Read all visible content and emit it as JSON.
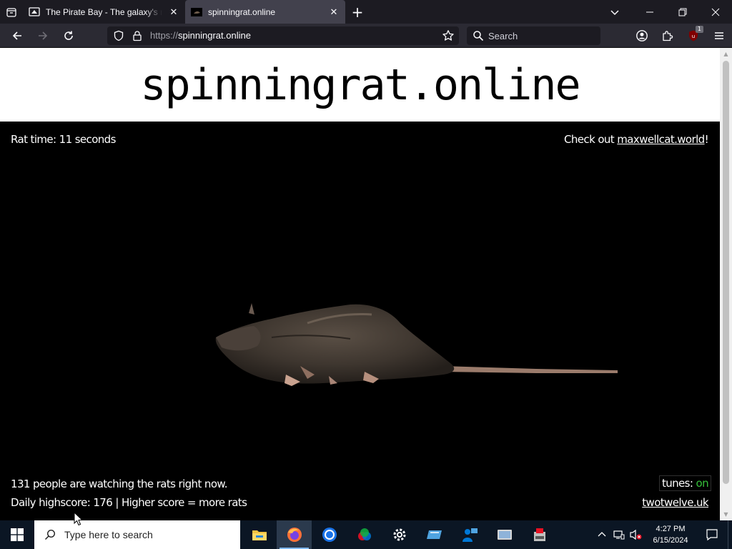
{
  "browser": {
    "tabs": [
      {
        "title": "The Pirate Bay - The galaxy's most resilient BitTorrent site",
        "active": false
      },
      {
        "title": "spinningrat.online",
        "active": true
      }
    ],
    "url_scheme": "https://",
    "url_host": "spinningrat.online",
    "search_placeholder": "Search",
    "extension_badge": "1"
  },
  "page": {
    "site_title": "spinningrat.online",
    "rat_time": "Rat time: 11 seconds",
    "checkout_prefix": "Check out ",
    "checkout_link": "maxwellcat.world",
    "checkout_suffix": "!",
    "watching": "131 people are watching the rats right now.",
    "highscore": "Daily highscore: 176 | Higher score = more rats",
    "tunes_label": "tunes: ",
    "tunes_state": "on",
    "footer_link": "twotwelve.uk"
  },
  "taskbar": {
    "search_placeholder": "Type here to search",
    "apps": [
      "file-explorer",
      "firefox",
      "chrome",
      "paint-3d",
      "settings",
      "mail",
      "people",
      "remote-desktop",
      "installer"
    ],
    "time": "4:27 PM",
    "date": "6/15/2024"
  },
  "colors": {
    "chrome_dark": "#1c1b22",
    "chrome_mid": "#2b2a33",
    "active_tab": "#42414d",
    "tunes_on": "#35c13a",
    "taskbar": "#0b1624"
  }
}
